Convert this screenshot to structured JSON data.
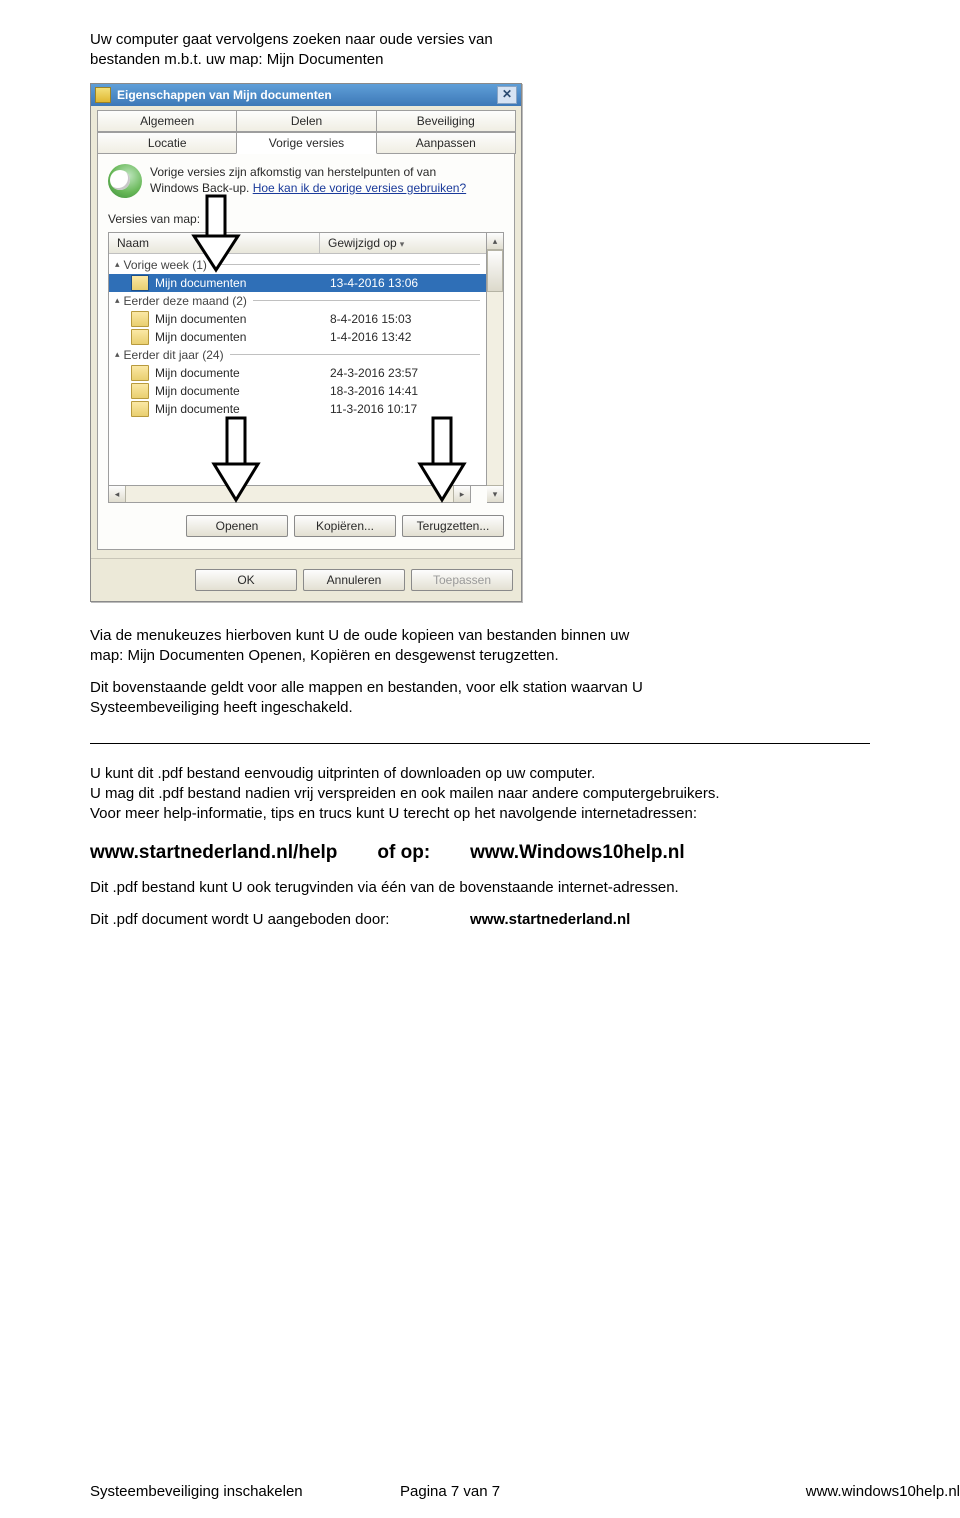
{
  "intro1": "Uw computer gaat vervolgens zoeken naar oude versies van",
  "intro2": "bestanden m.b.t. uw map:  Mijn Documenten",
  "dialog": {
    "title": "Eigenschappen van Mijn documenten",
    "tabs_row1": [
      "Algemeen",
      "Delen",
      "Beveiliging"
    ],
    "tabs_row2": [
      "Locatie",
      "Vorige versies",
      "Aanpassen"
    ],
    "active_tab": "Vorige versies",
    "explain1": "Vorige versies zijn afkomstig van herstelpunten of van",
    "explain2": "Windows Back-up. ",
    "help_link": "Hoe kan ik de vorige versies gebruiken?",
    "versions_label": "Versies van map:",
    "col_name": "Naam",
    "col_date": "Gewijzigd op",
    "groups": [
      {
        "label": "Vorige week (1)",
        "rows": [
          {
            "name": "Mijn documenten",
            "date": "13-4-2016 13:06",
            "selected": true
          }
        ]
      },
      {
        "label": "Eerder deze maand (2)",
        "rows": [
          {
            "name": "Mijn documenten",
            "date": "8-4-2016 15:03"
          },
          {
            "name": "Mijn documenten",
            "date": "1-4-2016 13:42"
          }
        ]
      },
      {
        "label": "Eerder dit jaar (24)",
        "rows": [
          {
            "name": "Mijn documente",
            "date": "24-3-2016 23:57"
          },
          {
            "name": "Mijn documente",
            "date": "18-3-2016 14:41"
          },
          {
            "name": "Mijn documente",
            "date": "11-3-2016 10:17"
          }
        ]
      }
    ],
    "btn_open": "Openen",
    "btn_copy": "Kopiëren...",
    "btn_restore": "Terugzetten...",
    "btn_ok": "OK",
    "btn_cancel": "Annuleren",
    "btn_apply": "Toepassen"
  },
  "para1a": "Via de menukeuzes hierboven kunt U de oude kopieen van bestanden binnen uw",
  "para1b": "map: Mijn Documenten Openen, Kopiëren en desgewenst terugzetten.",
  "para2a": "Dit bovenstaande geldt voor alle mappen en bestanden, voor elk station waarvan U",
  "para2b": "Systeembeveiliging heeft ingeschakeld.",
  "para3a": "U kunt dit .pdf bestand eenvoudig uitprinten of downloaden op uw computer.",
  "para3b": "U mag dit .pdf bestand nadien vrij verspreiden en ook mailen naar andere computergebruikers.",
  "para3c": "Voor meer help-informatie, tips en trucs kunt U terecht op het navolgende internetadressen:",
  "link_left": "www.startnederland.nl/help",
  "link_mid": "of op:",
  "link_right": "www.Windows10help.nl",
  "para4": "Dit .pdf bestand kunt U ook terugvinden via één van de bovenstaande internet-adressen.",
  "offered_label": "Dit .pdf document wordt U aangeboden door:",
  "offered_value": "www.startnederland.nl",
  "footer": {
    "left": "Systeembeveiliging inschakelen",
    "center": "Pagina 7 van 7",
    "right": "www.windows10help.nl"
  }
}
